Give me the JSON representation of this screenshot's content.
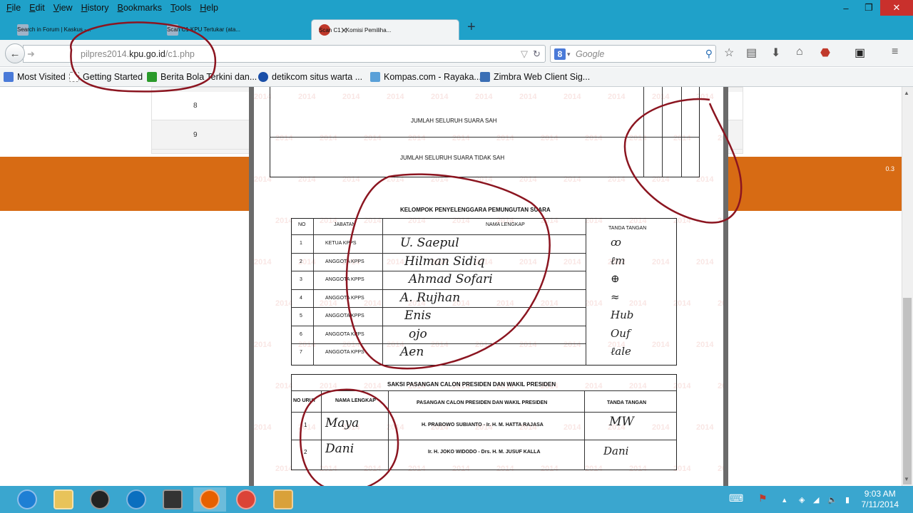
{
  "menu": [
    "File",
    "Edit",
    "View",
    "History",
    "Bookmarks",
    "Tools",
    "Help"
  ],
  "window_controls": {
    "minimize": "–",
    "maximize": "❐",
    "close": "✕"
  },
  "tabs": [
    {
      "label": "Search in Forum | Kaskus -...",
      "icon": "kaskus-icon",
      "active": false
    },
    {
      "label": "Scan C1 KPU Tertukar (ata...",
      "icon": "kaskus-icon",
      "active": false
    },
    {
      "label": "Scan C1 - Komisi Pemiliha...",
      "icon": "kpu-icon",
      "active": true
    }
  ],
  "new_tab_label": "+",
  "url": {
    "prefix": "pilpres2014.",
    "domain": "kpu.go.id",
    "path": "/c1.php"
  },
  "search": {
    "placeholder": "Google",
    "engine_letter": "8"
  },
  "bookmarks": [
    {
      "label": "Most Visited",
      "icon": "most-visited-icon",
      "color": "#4a7ad8"
    },
    {
      "label": "Getting Started",
      "icon": "page-icon",
      "color": "#dddddd"
    },
    {
      "label": "Berita Bola Terkini dan...",
      "icon": "runner-icon",
      "color": "#2a9a2a"
    },
    {
      "label": "detikcom  situs warta ...",
      "icon": "detik-icon",
      "color": "#1a4fa8"
    },
    {
      "label": "Kompas.com - Rayaka...",
      "icon": "kompas-icon",
      "color": "#5aa0d8"
    },
    {
      "label": "Zimbra Web Client Sig...",
      "icon": "zimbra-icon",
      "color": "#3b6fb5"
    }
  ],
  "background_table": {
    "rows": [
      "8",
      "9"
    ]
  },
  "orange_banner_text": "0.3",
  "document": {
    "vote_rows": [
      "JUMLAH SELURUH SUARA SAH",
      "JUMLAH SELURUH SUARA TIDAK SAH"
    ],
    "kpps_title": "KELOMPOK PENYELENGGARA PEMUNGUTAN SUARA",
    "kpps_headers": [
      "NO",
      "JABATAN",
      "NAMA LENGKAP",
      "TANDA TANGAN"
    ],
    "kpps_rows": [
      {
        "no": "1",
        "jabatan": "KETUA KPPS",
        "nama": "U. Saepul",
        "ttd": "ꝏ"
      },
      {
        "no": "2",
        "jabatan": "ANGGOTA KPPS",
        "nama": "Hilman Sidiq",
        "ttd": "ℓm"
      },
      {
        "no": "3",
        "jabatan": "ANGGOTA KPPS",
        "nama": "Ahmad Sofari",
        "ttd": "⊕"
      },
      {
        "no": "4",
        "jabatan": "ANGGOTA KPPS",
        "nama": "A. Rujhan",
        "ttd": "≈"
      },
      {
        "no": "5",
        "jabatan": "ANGGOTA KPPS",
        "nama": "Enis",
        "ttd": "Hub"
      },
      {
        "no": "6",
        "jabatan": "ANGGOTA KPPS",
        "nama": "ojo",
        "ttd": "Ouf"
      },
      {
        "no": "7",
        "jabatan": "ANGGOTA KPPS",
        "nama": "Aen",
        "ttd": "ℓale"
      }
    ],
    "saksi_title": "SAKSI PASANGAN CALON PRESIDEN DAN WAKIL PRESIDEN",
    "saksi_headers": [
      "NO URUT",
      "NAMA LENGKAP",
      "PASANGAN CALON PRESIDEN DAN WAKIL PRESIDEN",
      "TANDA TANGAN"
    ],
    "saksi_rows": [
      {
        "no": "1",
        "nama": "Maya",
        "pasangan": "H. PRABOWO SUBIANTO - Ir. H. M. HATTA RAJASA",
        "ttd": "MW"
      },
      {
        "no": "2",
        "nama": "Dani",
        "pasangan": "Ir. H. JOKO WIDODO - Drs. H. M. JUSUF KALLA",
        "ttd": "Dani"
      }
    ],
    "watermark": "2014"
  },
  "taskbar": {
    "apps": [
      {
        "name": "internet-explorer-icon",
        "color": "#1e7fd4"
      },
      {
        "name": "file-explorer-icon",
        "color": "#e8c35a"
      },
      {
        "name": "media-player-icon",
        "color": "#222222"
      },
      {
        "name": "hp-icon",
        "color": "#0a6fbf"
      },
      {
        "name": "video-app-icon",
        "color": "#333333"
      },
      {
        "name": "firefox-icon",
        "color": "#e66000"
      },
      {
        "name": "chrome-icon",
        "color": "#db4437"
      },
      {
        "name": "paint-icon",
        "color": "#d9a13a"
      }
    ],
    "time": "9:03 AM",
    "date": "7/11/2014"
  }
}
